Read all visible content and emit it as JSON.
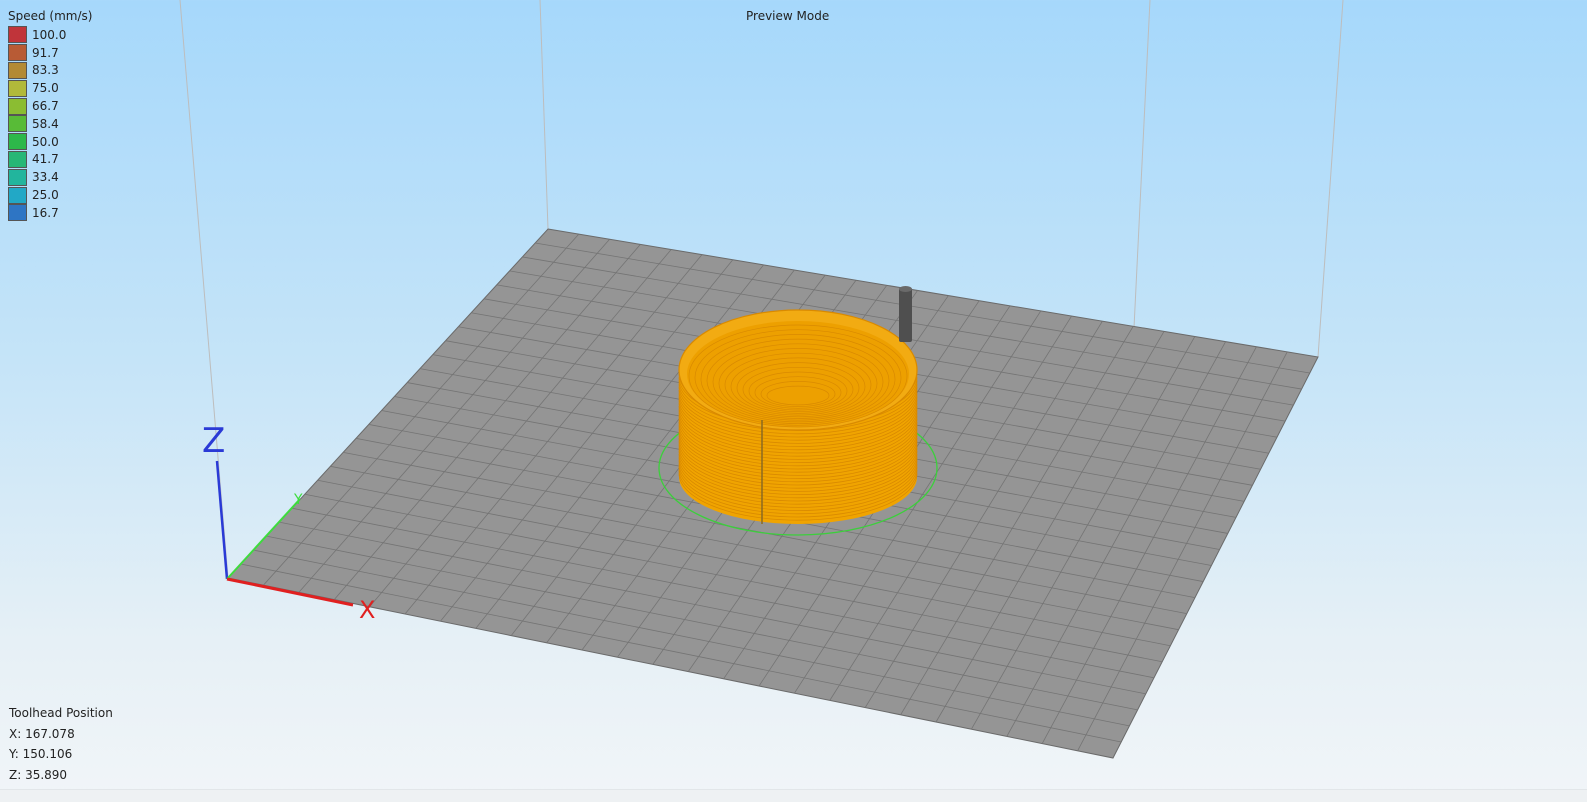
{
  "header": {
    "mode": "Preview Mode"
  },
  "legend": {
    "title": "Speed (mm/s)",
    "items": [
      {
        "value": "100.0",
        "color": "#c0343a"
      },
      {
        "value": "91.7",
        "color": "#b85b35"
      },
      {
        "value": "83.3",
        "color": "#b38a34"
      },
      {
        "value": "75.0",
        "color": "#b1b93a"
      },
      {
        "value": "66.7",
        "color": "#8bbd32"
      },
      {
        "value": "58.4",
        "color": "#58bb37"
      },
      {
        "value": "50.0",
        "color": "#2db84a"
      },
      {
        "value": "41.7",
        "color": "#27b776"
      },
      {
        "value": "33.4",
        "color": "#22b59d"
      },
      {
        "value": "25.0",
        "color": "#22a8c6"
      },
      {
        "value": "16.7",
        "color": "#2e75c4"
      }
    ]
  },
  "toolhead": {
    "title": "Toolhead Position",
    "x": "X: 167.078",
    "y": "Y: 150.106",
    "z": "Z: 35.890"
  },
  "axes": {
    "x_label": "X",
    "y_label": "Y",
    "z_label": "Z"
  },
  "colors": {
    "bed": "#959595",
    "grid": "#6e6e6e",
    "print": "#f0a400",
    "print_dark": "#d98a00",
    "skirt": "#3ccf3c",
    "nozzle": "#505050"
  }
}
